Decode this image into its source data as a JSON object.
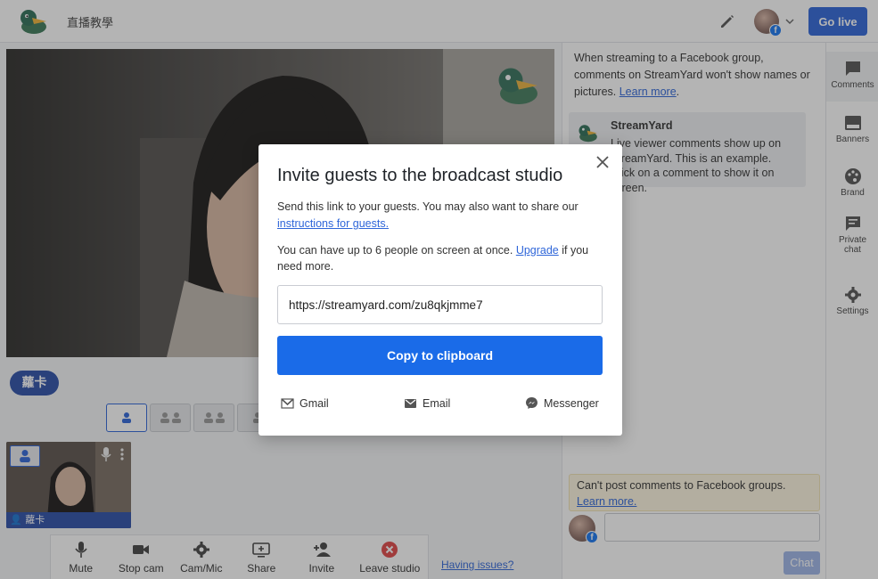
{
  "header": {
    "title": "直播教學",
    "go_live_label": "Go live"
  },
  "stage": {
    "presenter_name": "蘿卡"
  },
  "thumbnail": {
    "name": "蘿卡"
  },
  "toolbar": {
    "items": [
      {
        "label": "Mute",
        "icon": "mic-icon"
      },
      {
        "label": "Stop cam",
        "icon": "camera-icon"
      },
      {
        "label": "Cam/Mic",
        "icon": "gear-icon"
      },
      {
        "label": "Share",
        "icon": "screen-share-icon"
      },
      {
        "label": "Invite",
        "icon": "add-person-icon"
      },
      {
        "label": "Leave studio",
        "icon": "close-circle-icon"
      }
    ],
    "issues_link": "Having issues?"
  },
  "comments": {
    "fb_notice": "When streaming to a Facebook group, comments on StreamYard won't show names or pictures.",
    "learn_more": "Learn more",
    "sample_author": "StreamYard",
    "sample_text": "Live viewer comments show up on StreamYard. This is an example. Click on a comment to show it on screen.",
    "cant_post": "Can't post comments to Facebook groups.",
    "cant_post_link": "Learn more.",
    "chat_placeholder": "",
    "chat_button": "Chat"
  },
  "rail": {
    "items": [
      {
        "label": "Comments",
        "icon": "comment-icon",
        "active": true
      },
      {
        "label": "Banners",
        "icon": "banner-icon"
      },
      {
        "label": "Brand",
        "icon": "palette-icon"
      },
      {
        "label": "Private chat",
        "icon": "chat-bubble-icon"
      },
      {
        "label": "Settings",
        "icon": "gear-icon"
      }
    ]
  },
  "modal": {
    "title": "Invite guests to the broadcast studio",
    "p1_text": "Send this link to your guests. You may also want to share our ",
    "p1_link": "instructions for guests.",
    "p2_text": "You can have up to 6 people on screen at once. ",
    "p2_link": "Upgrade",
    "p2_tail": " if you need more.",
    "invite_link": "https://streamyard.com/zu8qkjmme7",
    "copy_label": "Copy to clipboard",
    "share": {
      "gmail": "Gmail",
      "email": "Email",
      "messenger": "Messenger"
    }
  },
  "colors": {
    "accent": "#1a6be8",
    "golive": "#2f66d9",
    "nametag": "#2b4fa8",
    "leave": "#e04848"
  }
}
